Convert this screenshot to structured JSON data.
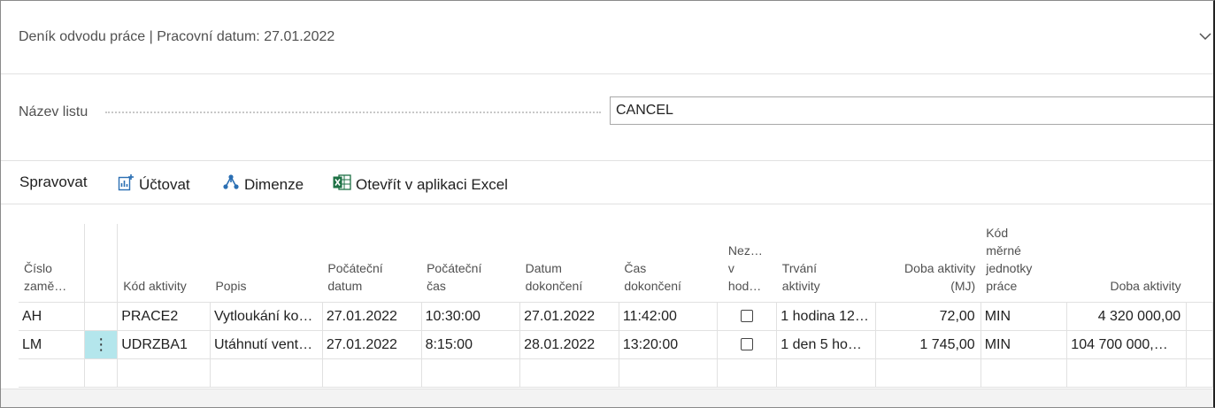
{
  "header": {
    "title": "Deník odvodu práce | Pracovní datum: 27.01.2022",
    "collapse_icon": "chevron-down-icon"
  },
  "field": {
    "label": "Název listu",
    "value": "CANCEL"
  },
  "toolbar": {
    "manage_label": "Spravovat",
    "post_label": "Účtovat",
    "post_icon": "post-icon",
    "dimensions_label": "Dimenze",
    "dimensions_icon": "dimensions-icon",
    "excel_label": "Otevřít v aplikaci Excel",
    "excel_icon": "excel-icon"
  },
  "table": {
    "columns": [
      "Číslo\nzamě…",
      "",
      "Kód aktivity",
      "Popis",
      "Počáteční\ndatum",
      "Počáteční\nčas",
      "Datum\ndokončení",
      "Čas\ndokončení",
      "Nez…\nv\nhod…",
      "Trvání\naktivity",
      "Doba aktivity\n(MJ)",
      "Kód\nměrné\njednotky\npráce",
      "Doba aktivity"
    ],
    "rows": [
      {
        "employee": "AH",
        "activity_code": "PRACE2",
        "description": "Vytloukání ko…",
        "start_date": "27.01.2022",
        "start_time": "10:30:00",
        "end_date": "27.01.2022",
        "end_time": "11:42:00",
        "checked": false,
        "duration": "1 hodina 12…",
        "duration_uom": "72,00",
        "uom_code": "MIN",
        "duration_total": "4 320 000,00"
      },
      {
        "employee": "LM",
        "activity_code": "UDRZBA1",
        "description": "Utáhnutí vent…",
        "start_date": "27.01.2022",
        "start_time": "8:15:00",
        "end_date": "28.01.2022",
        "end_time": "13:20:00",
        "checked": false,
        "duration": "1 den 5 ho…",
        "duration_uom": "1 745,00",
        "uom_code": "MIN",
        "duration_total": "104 700 000,…"
      }
    ],
    "row_menu_glyph": "⋮",
    "row_menu_icon": "more-options-icon"
  }
}
